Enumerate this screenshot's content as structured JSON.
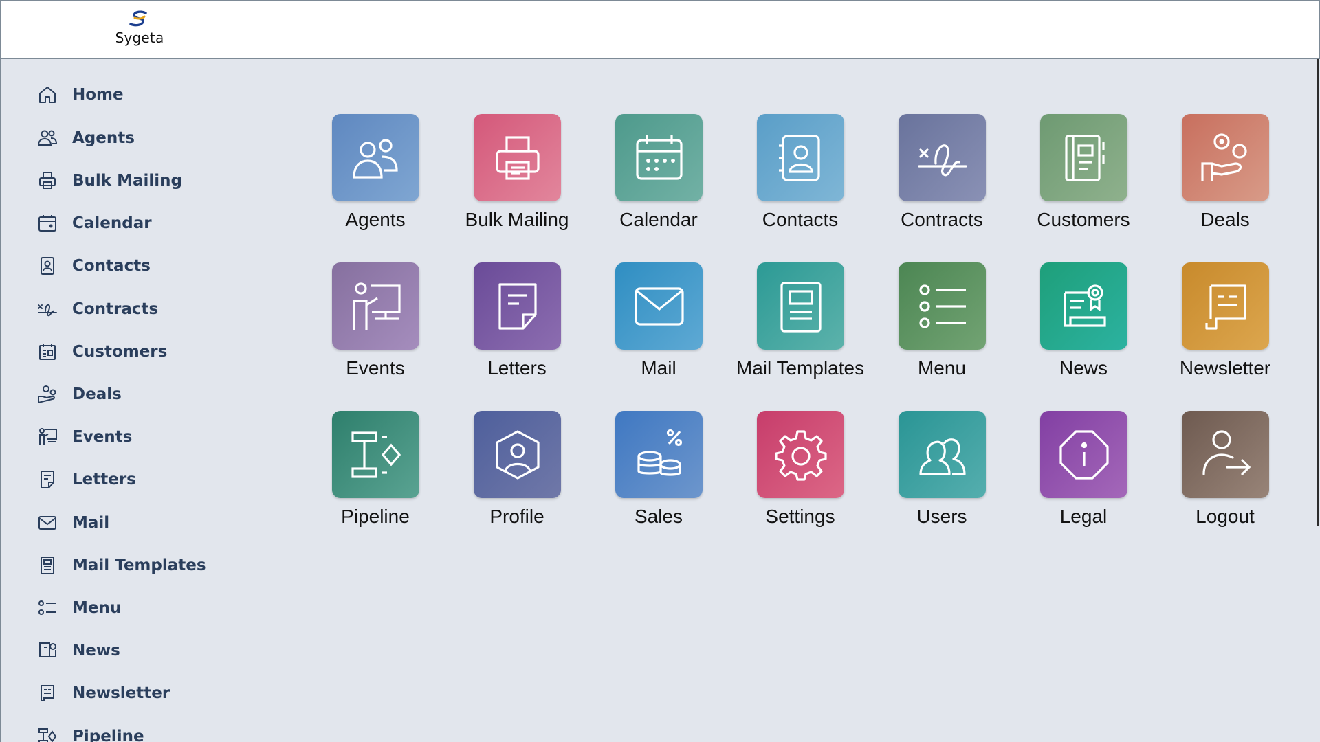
{
  "app": {
    "name": "Sygeta"
  },
  "sidebar": {
    "items": [
      {
        "label": "Home",
        "icon": "home-icon"
      },
      {
        "label": "Agents",
        "icon": "agents-icon"
      },
      {
        "label": "Bulk Mailing",
        "icon": "printer-icon"
      },
      {
        "label": "Calendar",
        "icon": "calendar-icon"
      },
      {
        "label": "Contacts",
        "icon": "contact-card-icon"
      },
      {
        "label": "Contracts",
        "icon": "signature-icon"
      },
      {
        "label": "Customers",
        "icon": "customers-icon"
      },
      {
        "label": "Deals",
        "icon": "deals-icon"
      },
      {
        "label": "Events",
        "icon": "presentation-icon"
      },
      {
        "label": "Letters",
        "icon": "letter-icon"
      },
      {
        "label": "Mail",
        "icon": "mail-icon"
      },
      {
        "label": "Mail Templates",
        "icon": "template-icon"
      },
      {
        "label": "Menu",
        "icon": "menu-list-icon"
      },
      {
        "label": "News",
        "icon": "news-icon"
      },
      {
        "label": "Newsletter",
        "icon": "newsletter-icon"
      },
      {
        "label": "Pipeline",
        "icon": "pipeline-icon"
      }
    ]
  },
  "tiles": [
    {
      "label": "Agents",
      "icon": "agents-icon",
      "colors": [
        "#5f88c0",
        "#7fa6d2"
      ]
    },
    {
      "label": "Bulk Mailing",
      "icon": "printer-icon",
      "colors": [
        "#d4587a",
        "#e2869c"
      ]
    },
    {
      "label": "Calendar",
      "icon": "calendar-icon",
      "colors": [
        "#4e9a8c",
        "#72b1a5"
      ]
    },
    {
      "label": "Contacts",
      "icon": "contact-card-icon",
      "colors": [
        "#5a9ec8",
        "#7fb6d6"
      ]
    },
    {
      "label": "Contracts",
      "icon": "signature-icon",
      "colors": [
        "#69739c",
        "#8a91b5"
      ]
    },
    {
      "label": "Customers",
      "icon": "customers-icon",
      "colors": [
        "#6e9a72",
        "#8fb18d"
      ]
    },
    {
      "label": "Deals",
      "icon": "deals-icon",
      "colors": [
        "#c86f5e",
        "#d89b88"
      ]
    },
    {
      "label": "Events",
      "icon": "presentation-icon",
      "colors": [
        "#86709f",
        "#a58dbd"
      ]
    },
    {
      "label": "Letters",
      "icon": "letter-icon",
      "colors": [
        "#6a4b98",
        "#8c6db0"
      ]
    },
    {
      "label": "Mail",
      "icon": "mail-icon",
      "colors": [
        "#2f8ec2",
        "#5ea9d4"
      ]
    },
    {
      "label": "Mail Templates",
      "icon": "template-icon",
      "colors": [
        "#2c9a95",
        "#5cb2ab"
      ]
    },
    {
      "label": "Menu",
      "icon": "menu-list-icon",
      "colors": [
        "#4c8653",
        "#72a373"
      ]
    },
    {
      "label": "News",
      "icon": "news-icon",
      "colors": [
        "#1e9f7a",
        "#2cb2a0"
      ]
    },
    {
      "label": "Newsletter",
      "icon": "newsletter-icon",
      "colors": [
        "#c88a2c",
        "#dca64e"
      ]
    },
    {
      "label": "Pipeline",
      "icon": "pipeline-icon",
      "colors": [
        "#2e7f6c",
        "#5aa392"
      ]
    },
    {
      "label": "Profile",
      "icon": "profile-icon",
      "colors": [
        "#4e5f9c",
        "#7078a8"
      ]
    },
    {
      "label": "Sales",
      "icon": "sales-icon",
      "colors": [
        "#3f78c2",
        "#6d96cc"
      ]
    },
    {
      "label": "Settings",
      "icon": "gear-icon",
      "colors": [
        "#c73d6b",
        "#dc6786"
      ]
    },
    {
      "label": "Users",
      "icon": "users-icon",
      "colors": [
        "#2a9595",
        "#55aeae"
      ]
    },
    {
      "label": "Legal",
      "icon": "info-octagon-icon",
      "colors": [
        "#823fa3",
        "#a468b9"
      ]
    },
    {
      "label": "Logout",
      "icon": "logout-icon",
      "colors": [
        "#6e5a50",
        "#988478"
      ]
    }
  ]
}
